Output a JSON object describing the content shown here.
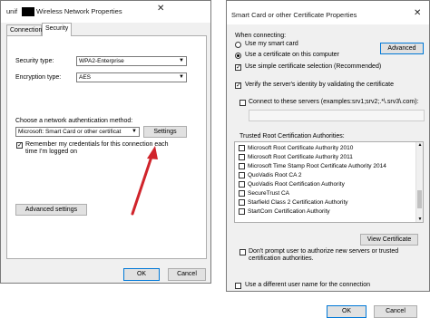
{
  "left_window": {
    "title": "Wireless Network Properties",
    "title_prefix": "unif",
    "close_glyph": "✕",
    "tabs": [
      "Connection",
      "Security"
    ],
    "security_type_label": "Security type:",
    "security_type_value": "WPA2-Enterprise",
    "encryption_type_label": "Encryption type:",
    "encryption_type_value": "AES",
    "auth_method_label": "Choose a network authentication method:",
    "auth_method_value": "Microsoft: Smart Card or other certificat",
    "settings_button": "Settings",
    "remember_label_line1": "Remember my credentials for this connection each",
    "remember_label_line2": "time I'm logged on",
    "advanced_button": "Advanced settings",
    "ok_button": "OK",
    "cancel_button": "Cancel",
    "arrow_color": "#d0242b"
  },
  "right_window": {
    "title": "Smart Card or other Certificate Properties",
    "close_glyph": "✕",
    "when_connecting_label": "When connecting:",
    "use_smart_card_label": "Use my smart card",
    "advanced_button": "Advanced",
    "use_cert_label": "Use a certificate on this computer",
    "simple_cert_label": "Use simple certificate selection (Recommended)",
    "verify_identity_label": "Verify the server's identity by validating the certificate",
    "connect_servers_label": "Connect to these servers (examples:srv1;srv2;.*\\.srv3\\.com):",
    "trusted_root_label": "Trusted Root Certification Authorities:",
    "authorities": [
      "Microsoft Root Certificate Authority 2010",
      "Microsoft Root Certificate Authority 2011",
      "Microsoft Time Stamp Root Certificate Authority 2014",
      "QuoVadis Root CA 2",
      "QuoVadis Root Certification Authority",
      "SecureTrust CA",
      "Starfield Class 2 Certification Authority",
      "StartCom Certification Authority"
    ],
    "view_certificate_button": "View Certificate",
    "dont_prompt_line1": "Don't prompt user to authorize new servers or trusted",
    "dont_prompt_line2": "certification authorities.",
    "different_user_label": "Use a different user name for the connection",
    "ok_button": "OK",
    "cancel_button": "Cancel"
  }
}
